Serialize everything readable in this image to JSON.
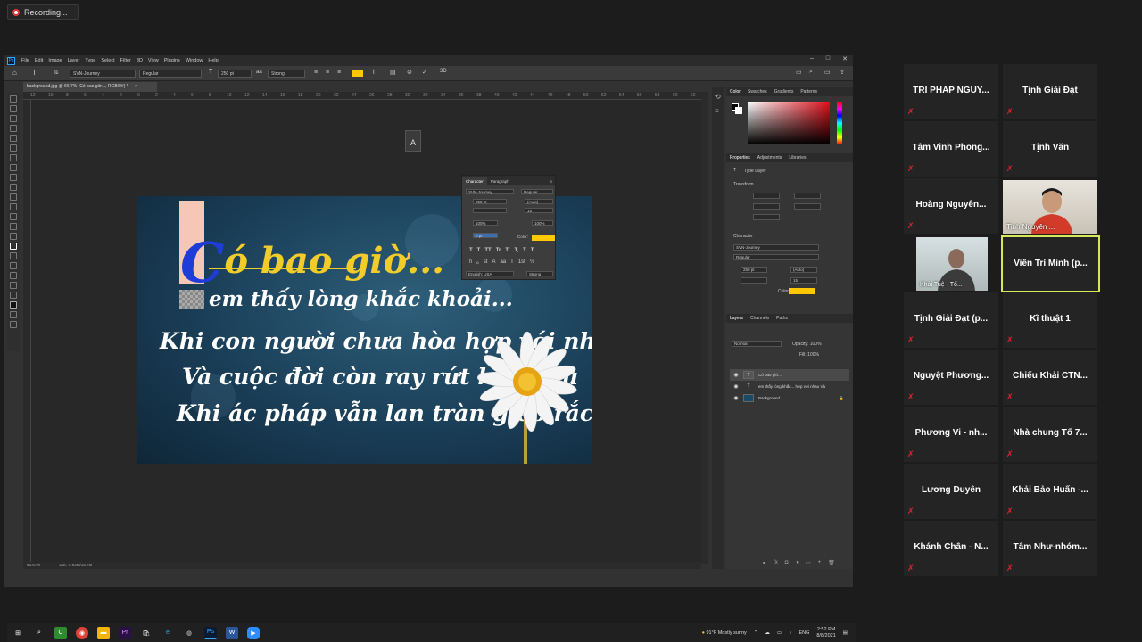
{
  "recording": {
    "label": "Recording..."
  },
  "photoshop": {
    "menu": [
      "File",
      "Edit",
      "Image",
      "Layer",
      "Type",
      "Select",
      "Filter",
      "3D",
      "View",
      "Plugins",
      "Window",
      "Help"
    ],
    "options": {
      "font": "SVN-Journey",
      "style": "Regular",
      "size": "250 pt",
      "antialias": "Strong"
    },
    "doc_tab": "background.jpg @ 66.7% (Có bao giờ..., RGB/8#) *",
    "ruler_ticks": [
      "12",
      "10",
      "8",
      "6",
      "4",
      "2",
      "0",
      "2",
      "4",
      "6",
      "8",
      "10",
      "12",
      "14",
      "16",
      "18",
      "20",
      "22",
      "24",
      "26",
      "28",
      "30",
      "32",
      "34",
      "36",
      "38",
      "40",
      "42",
      "44",
      "46",
      "48",
      "50",
      "52",
      "54",
      "56",
      "58",
      "60",
      "62"
    ],
    "status": {
      "zoom": "66.67%",
      "doc": "Doc: 5.93M/15.7M"
    },
    "artwork": {
      "heading_cap": "C",
      "heading_rest": "ó bao giờ...",
      "lines": [
        "em thấy lòng khắc khoải...",
        "Khi con người chưa hòa hợp với nhau",
        "Và cuộc đời còn ray rứt khổ đau",
        "Khi ác pháp vẫn lan tràn gieo rắc"
      ]
    },
    "character_panel": {
      "tabs": [
        "Character",
        "Paragraph"
      ],
      "font": "SVN-Journey",
      "style": "Regular",
      "size": "250 pt",
      "leading": "(Auto)",
      "tracking": "15",
      "vscale": "100%",
      "hscale": "100%",
      "baseline": "0 pt",
      "color_label": "Color:",
      "language": "English: USA",
      "aa": "Strong",
      "type_buttons": [
        "T",
        "T",
        "TT",
        "Tr",
        "T'",
        "T,",
        "T",
        "T"
      ],
      "ot_buttons": [
        "fi",
        "ℴ",
        "st",
        "A",
        "aa",
        "T",
        "1st",
        "½"
      ]
    },
    "panels": {
      "color_tabs": [
        "Color",
        "Swatches",
        "Gradients",
        "Patterns"
      ],
      "props_tabs": [
        "Properties",
        "Adjustments",
        "Libraries"
      ],
      "type_layer": "Type Layer",
      "transform": "Transform",
      "character": "Character",
      "font": "SVN-Journey",
      "style": "Regular",
      "size": "250 pt",
      "leading": "(Auto)",
      "tracking": "15",
      "color_label": "Color",
      "layers_tabs": [
        "Layers",
        "Channels",
        "Paths"
      ],
      "blend": "Normal",
      "opacity": "Opacity: 100%",
      "fill": "Fill: 100%",
      "layers": [
        {
          "name": "Có bao giờ...",
          "thumb": "T",
          "active": true
        },
        {
          "name": "em thấy lòng khắc... hợp với nhau Và",
          "thumb": "T",
          "active": false
        },
        {
          "name": "Background",
          "thumb": "",
          "active": false
        }
      ]
    },
    "taskbar": {
      "weather": "91°F  Mostly sunny",
      "lang": "ENG",
      "time": "2:52 PM",
      "date": "8/8/2021"
    }
  },
  "participants": [
    {
      "name": "TRÍ PHÁP NGUY...",
      "video": false
    },
    {
      "name": "Tịnh Giải Đạt",
      "video": false
    },
    {
      "name": "Tâm Vinh Phong...",
      "video": false
    },
    {
      "name": "Tịnh Văn",
      "video": false
    },
    {
      "name": "Hoàng Nguyên...",
      "video": false
    },
    {
      "name": "Tịnh Nguyên ...",
      "video": true
    },
    {
      "name": "Khải Tuệ - Tổ...",
      "video": true
    },
    {
      "name": "Viên Trí Minh (p...",
      "video": false,
      "active": true
    },
    {
      "name": "Tịnh Giải Đạt (p...",
      "video": false
    },
    {
      "name": "Kĩ thuật 1",
      "video": false
    },
    {
      "name": "Nguyệt Phương...",
      "video": false
    },
    {
      "name": "Chiếu Khải CTN...",
      "video": false
    },
    {
      "name": "Phương Vi - nh...",
      "video": false
    },
    {
      "name": "Nhà chung Tổ 7...",
      "video": false
    },
    {
      "name": "Lương Duyên",
      "video": false
    },
    {
      "name": "Khải Bảo Huấn -...",
      "video": false
    },
    {
      "name": "Khánh Chân - N...",
      "video": false
    },
    {
      "name": "Tâm Như-nhóm...",
      "video": false
    }
  ]
}
